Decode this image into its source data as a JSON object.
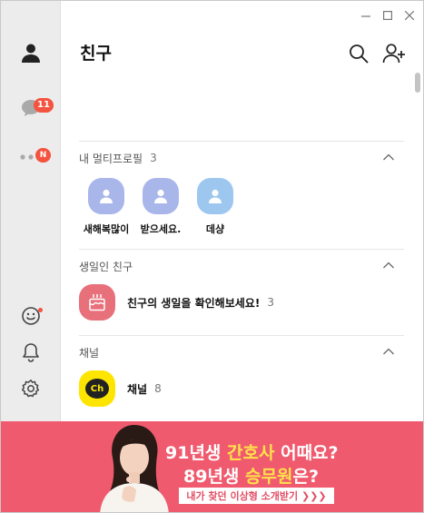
{
  "header": {
    "title": "친구"
  },
  "sidebar": {
    "chat_badge": "11",
    "more_badge": "N"
  },
  "sections": {
    "multiprofile": {
      "title": "내 멀티프로필",
      "count": "3",
      "profiles": [
        {
          "name": "새해복많이",
          "color": "#a9b6ea"
        },
        {
          "name": "받으세요.",
          "color": "#a9b6ea"
        },
        {
          "name": "데샹",
          "color": "#9ec7f0"
        }
      ]
    },
    "birthday": {
      "title": "생일인 친구",
      "row_label": "친구의 생일을 확인해보세요!",
      "row_count": "3",
      "icon_color": "#e8707a"
    },
    "channel": {
      "title": "채널",
      "row_label": "채널",
      "row_count": "8",
      "logo_text": "Ch",
      "logo_color": "#fee500"
    }
  },
  "ad": {
    "line1_a": "91년생 ",
    "line1_hl": "간호사",
    "line1_b": " 어때요?",
    "line2_a": "89년생 ",
    "line2_hl": "승무원",
    "line2_b": "은?",
    "cta": "내가 찾던 이상형 소개받기 ❯❯❯",
    "bg_color": "#f05a6e"
  },
  "colors": {
    "badge": "#f4533f",
    "rail": "#ececec"
  }
}
